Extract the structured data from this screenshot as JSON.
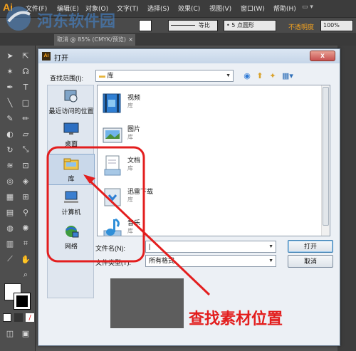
{
  "app": {
    "logo": "Ai",
    "menu": [
      "文件(F)",
      "编辑(E)",
      "对象(O)",
      "文字(T)",
      "选择(S)",
      "效果(C)",
      "视图(V)",
      "窗口(W)",
      "帮助(H)"
    ]
  },
  "controlbar": {
    "stroke_style": "等比",
    "brush": "5 点圆形",
    "opacity_label": "不透明度",
    "opacity_value": "100%"
  },
  "doc_tab": {
    "label": "取消 @ 85% (CMYK/预览)",
    "close": "×"
  },
  "watermark": {
    "text": "河东软件园"
  },
  "dialog": {
    "title": "打开",
    "close": "x",
    "lookin_label": "查找范围(I):",
    "lookin_value": "库",
    "places": [
      {
        "label": "最近访问的位置",
        "icon": "recent-places-icon"
      },
      {
        "label": "桌面",
        "icon": "desktop-icon"
      },
      {
        "label": "库",
        "icon": "library-folder-icon",
        "active": true
      },
      {
        "label": "计算机",
        "icon": "computer-icon"
      },
      {
        "label": "网络",
        "icon": "network-icon"
      }
    ],
    "files": [
      {
        "name": "视频",
        "sub": "库",
        "icon": "video-library-icon"
      },
      {
        "name": "图片",
        "sub": "库",
        "icon": "pictures-library-icon"
      },
      {
        "name": "文档",
        "sub": "库",
        "icon": "documents-library-icon"
      },
      {
        "name": "迅雷下载",
        "sub": "库",
        "icon": "download-library-icon"
      },
      {
        "name": "音乐",
        "sub": "库",
        "icon": "music-library-icon"
      }
    ],
    "filename_label": "文件名(N):",
    "filename_value": "|",
    "filetype_label": "文件类型(T):",
    "filetype_value": "所有格式",
    "open_button": "打开",
    "cancel_button": "取消"
  },
  "annotation": {
    "text": "查找素材位置",
    "color": "#e31e1e"
  }
}
